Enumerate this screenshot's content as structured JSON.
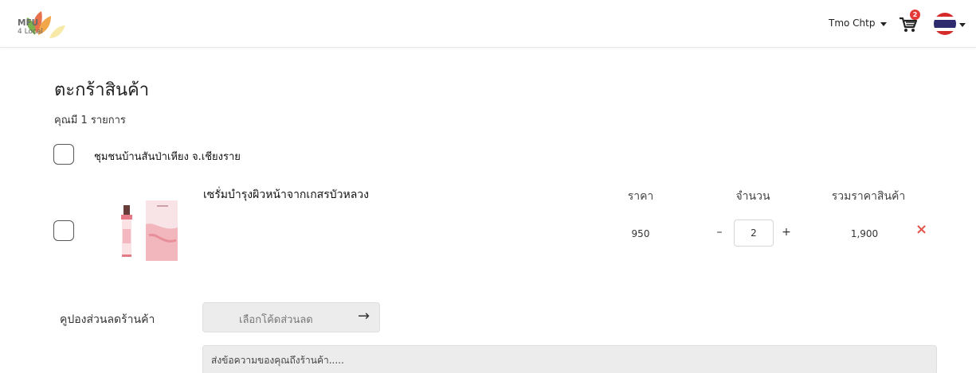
{
  "header": {
    "logo_text_line1": "MFU",
    "logo_text_line2": "4 Local",
    "user_name": "Tmo Chtp",
    "cart_count": "2",
    "language": "th"
  },
  "page": {
    "title": "ตะกร้าสินค้า",
    "item_count_text": "คุณมี 1 รายการ"
  },
  "shop": {
    "name": "ชุมชนบ้านสันป่าเหียง จ.เชียงราย"
  },
  "columns": {
    "price": "ราคา",
    "quantity": "จำนวน",
    "total": "รวมราคาสินค้า"
  },
  "item": {
    "name": "เซรั่มบำรุงผิวหน้าจากเกสรบัวหลวง",
    "price": "950",
    "quantity": "2",
    "total": "1,900",
    "minus": "–",
    "plus": "+",
    "remove": "×"
  },
  "coupon": {
    "label": "คูปองส่วนลดร้านค้า",
    "button_text": "เลือกโค้ดส่วนลด",
    "arrow": "→"
  },
  "message": {
    "placeholder": "ส่งข้อความของคุณถึงร้านค้า....."
  },
  "colors": {
    "remove": "#e2574c",
    "badge": "#e53935",
    "input_bg": "#ececec"
  }
}
